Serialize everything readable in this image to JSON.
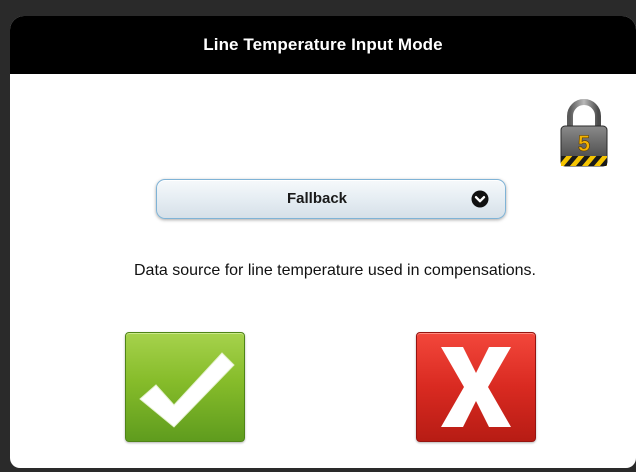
{
  "dialog": {
    "title": "Line Temperature Input Mode",
    "lock": {
      "icon": "padlock-icon",
      "level": "5",
      "colors": {
        "body": "#6e6e6e",
        "number": "#f5b400",
        "stripe": "#f5c400"
      }
    },
    "dropdown": {
      "selected": "Fallback",
      "icon": "chevron-down-circle-icon"
    },
    "description": "Data source for line temperature used in compensations.",
    "buttons": {
      "confirm": {
        "icon": "checkmark-icon",
        "color": "#86bc2a"
      },
      "cancel": {
        "icon": "x-icon",
        "color": "#d92a21"
      }
    }
  }
}
